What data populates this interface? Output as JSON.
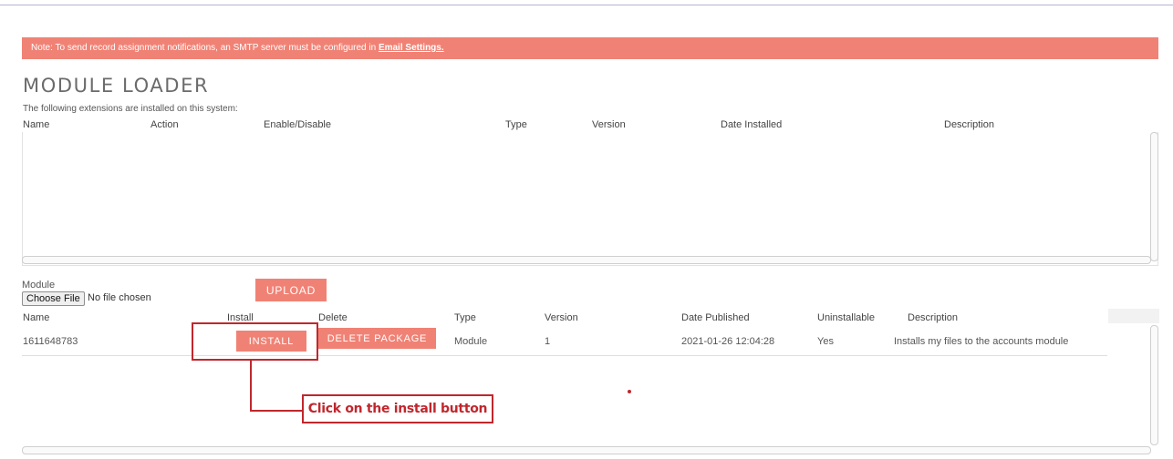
{
  "notice": {
    "text": "Note: To send record assignment notifications, an SMTP server must be configured in ",
    "link": "Email Settings."
  },
  "page": {
    "title": "MODULE LOADER",
    "installed_subtitle": "The following extensions are installed on this system:"
  },
  "installed_table": {
    "columns": [
      "Name",
      "Action",
      "Enable/Disable",
      "Type",
      "Version",
      "Date Installed",
      "Description"
    ]
  },
  "upload": {
    "module_label": "Module",
    "choose_file_label": "Choose File",
    "no_file_text": "No file chosen",
    "upload_label": "UPLOAD"
  },
  "packages_table": {
    "columns": [
      "Name",
      "Install",
      "Delete",
      "Type",
      "Version",
      "Date Published",
      "Uninstallable",
      "Description"
    ],
    "rows": [
      {
        "name": "1611648783",
        "install_label": "INSTALL",
        "delete_label": "DELETE PACKAGE",
        "type": "Module",
        "version": "1",
        "date_published": "2021-01-26 12:04:28",
        "uninstallable": "Yes",
        "description": "Installs my files to the accounts module"
      }
    ]
  },
  "annotation": {
    "callout_text": "Click on the install button",
    "color": "#c0272d"
  },
  "colors": {
    "accent": "#f08275"
  }
}
